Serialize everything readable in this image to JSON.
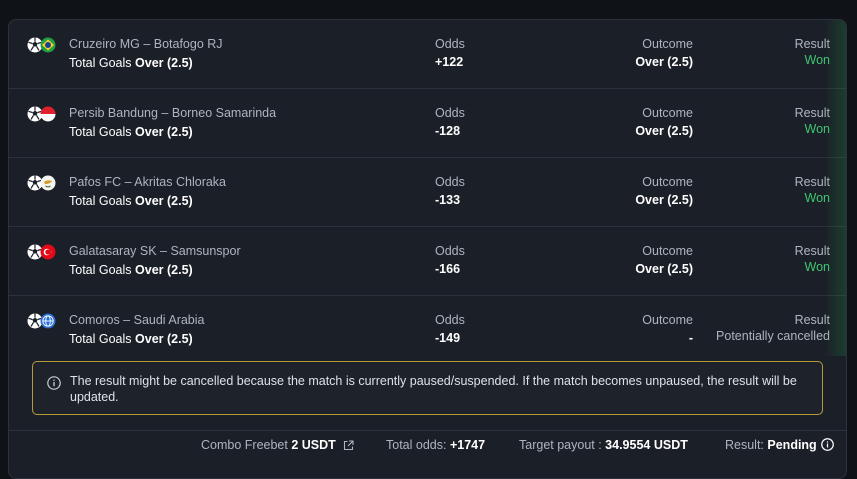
{
  "bets": [
    {
      "match": "Cruzeiro MG – Botafogo RJ",
      "market_prefix": "Total Goals ",
      "market_bold": "Over (2.5)",
      "odds_label": "Odds",
      "odds": "+122",
      "outcome_label": "Outcome",
      "outcome": "Over (2.5)",
      "result_label": "Result",
      "result": "Won",
      "flag": "brazil"
    },
    {
      "match": "Persib Bandung – Borneo Samarinda",
      "market_prefix": "Total Goals ",
      "market_bold": "Over (2.5)",
      "odds_label": "Odds",
      "odds": "-128",
      "outcome_label": "Outcome",
      "outcome": "Over (2.5)",
      "result_label": "Result",
      "result": "Won",
      "flag": "indonesia"
    },
    {
      "match": "Pafos FC – Akritas Chloraka",
      "market_prefix": "Total Goals ",
      "market_bold": "Over (2.5)",
      "odds_label": "Odds",
      "odds": "-133",
      "outcome_label": "Outcome",
      "outcome": "Over (2.5)",
      "result_label": "Result",
      "result": "Won",
      "flag": "cyprus"
    },
    {
      "match": "Galatasaray SK – Samsunspor",
      "market_prefix": "Total Goals ",
      "market_bold": "Over (2.5)",
      "odds_label": "Odds",
      "odds": "-166",
      "outcome_label": "Outcome",
      "outcome": "Over (2.5)",
      "result_label": "Result",
      "result": "Won",
      "flag": "turkey"
    },
    {
      "match": "Comoros – Saudi Arabia",
      "market_prefix": "Total Goals ",
      "market_bold": "Over (2.5)",
      "odds_label": "Odds",
      "odds": "-149",
      "outcome_label": "Outcome",
      "outcome": "-",
      "result_label": "Result",
      "result": "Potentially cancelled",
      "flag": "world"
    }
  ],
  "notice": {
    "text": "The result might be cancelled because the match is currently paused/suspended. If the match becomes unpaused, the result will be updated.",
    "icon": "info-icon"
  },
  "footer": {
    "combo_label": "Combo Freebet ",
    "combo_value": "2 USDT",
    "total_label": "Total odds: ",
    "total_value": "+1747",
    "target_label": "Target payout : ",
    "target_value": "34.9554 USDT",
    "result_label": "Result: ",
    "result_value": "Pending"
  },
  "colors": {
    "won": "#3fc671",
    "notice_border": "#b99a3a",
    "card_bg": "#1b1f27"
  }
}
